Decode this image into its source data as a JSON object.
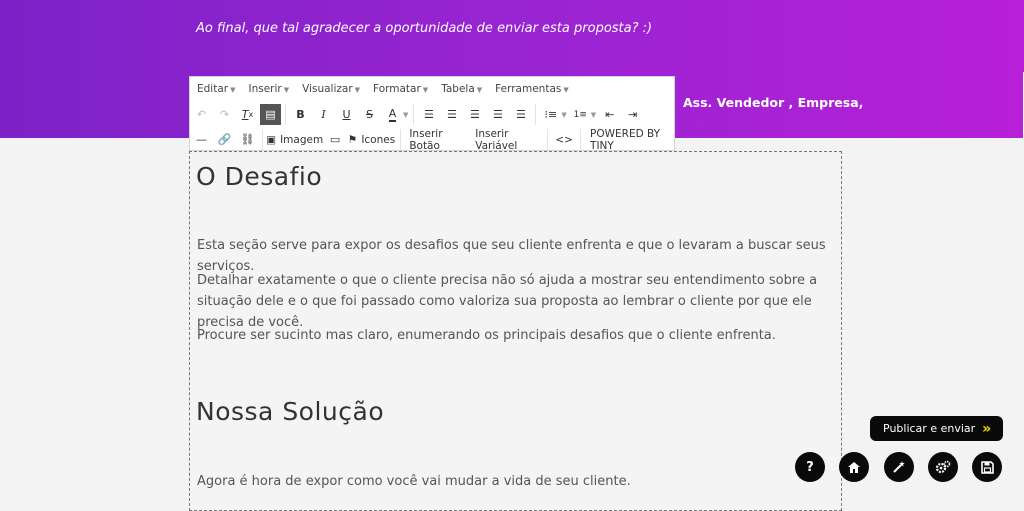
{
  "hero": {
    "note": "Ao final, que tal agradecer a oportunidade de enviar esta proposta? :)",
    "signature": "Ass. Vendedor , Empresa,"
  },
  "toolbar": {
    "menus": [
      "Editar",
      "Inserir",
      "Visualizar",
      "Formatar",
      "Tabela",
      "Ferramentas"
    ],
    "image_label": "Imagem",
    "icons_label": "Icones",
    "insert_button_label": "Inserir Botão",
    "insert_variable_label": "Inserir Variável",
    "code_label": "<>",
    "powered_by": "POWERED BY TINY"
  },
  "editor": {
    "heading1": "O Desafio",
    "p1": "Esta seção serve para expor os desafios que seu cliente enfrenta e que o levaram a buscar seus serviços.",
    "p2": "Detalhar exatamente o que o cliente precisa não só ajuda a mostrar seu entendimento sobre a situação dele e o que foi passado como valoriza sua proposta ao lembrar o cliente por que ele precisa de você.",
    "p3": "Procure ser sucinto mas claro, enumerando os principais desafios que o cliente enfrenta.",
    "heading2": "Nossa Solução",
    "p4": "Agora é hora de expor como você vai mudar a vida de seu cliente."
  },
  "actions": {
    "publish_label": "Publicar e enviar",
    "help_label": "?"
  },
  "colors": {
    "hero_start": "#7d22c8",
    "hero_end": "#b81fd9",
    "publish_bg": "#0a0a0a",
    "publish_chevron": "#f5e000"
  },
  "icons": [
    "undo-icon",
    "redo-icon",
    "clear-format-icon",
    "paste-icon",
    "bold-icon",
    "italic-icon",
    "underline-icon",
    "strikethrough-icon",
    "text-color-icon",
    "align-left-icon",
    "align-center-icon",
    "align-right-icon",
    "justify-icon",
    "align-none-icon",
    "bullet-list-icon",
    "numbered-list-icon",
    "outdent-icon",
    "indent-icon",
    "horizontal-rule-icon",
    "link-icon",
    "unlink-icon",
    "image-icon",
    "media-icon",
    "flag-icon",
    "help-icon",
    "home-icon",
    "magic-wand-icon",
    "settings-icon",
    "save-icon"
  ]
}
